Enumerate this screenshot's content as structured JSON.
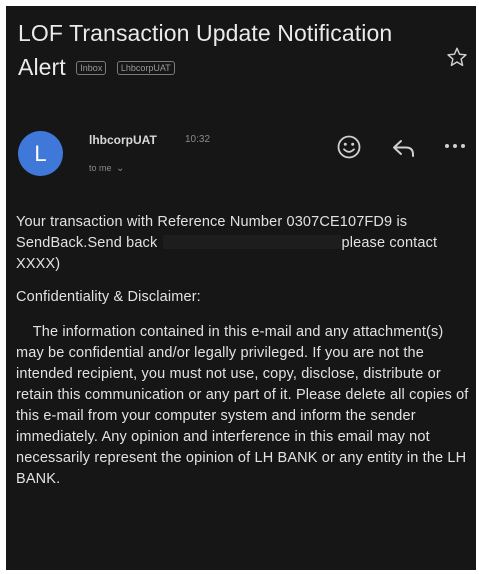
{
  "email": {
    "subject": "LOF Transaction Update Notification Alert",
    "labels": [
      "Inbox",
      "LhbcorpUAT"
    ],
    "sender": {
      "avatar_letter": "L",
      "name": "lhbcorpUAT",
      "time": "10:32",
      "recipient": "to me",
      "chevron": "⌄"
    },
    "body": {
      "line1_before": "Your transaction with Reference Number 0307CE107FD9 is SendBack.Send back",
      "line1_after": "please contact XXXX)",
      "disclaimer_title": "Confidentiality & Disclaimer:",
      "disclaimer_text": "    The information contained in this e-mail and any attachment(s) may be confidential and/or legally privileged. If you are not the intended recipient, you must not use, copy, disclose, distribute or retain this communication or any part of it. Please delete all copies of this e-mail from your computer system and inform the sender immediately. Any opinion and interference in this email may not necessarily represent the opinion of LH BANK or any entity in the LH BANK."
    }
  },
  "icons": {
    "star": "star-icon",
    "emoji": "emoji-icon",
    "reply": "reply-icon",
    "more": "more-icon"
  },
  "colors": {
    "background": "#161616",
    "avatar": "#3f78d8",
    "text": "#e2e2e2",
    "muted": "#8a8a8a"
  }
}
